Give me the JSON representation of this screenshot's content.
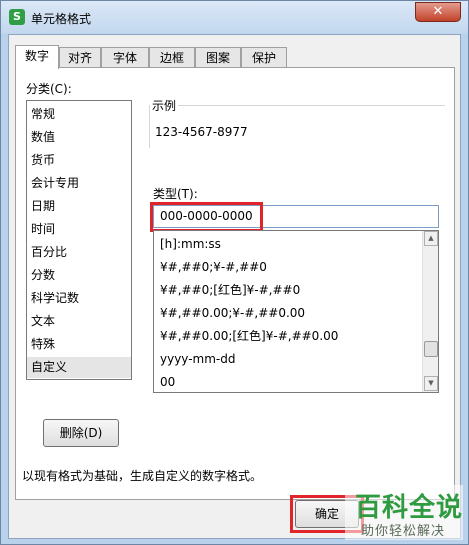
{
  "window": {
    "title": "单元格格式",
    "app_icon_glyph": "S",
    "close_glyph": "✕"
  },
  "tabs": [
    {
      "label": "数字",
      "active": true
    },
    {
      "label": "对齐",
      "active": false
    },
    {
      "label": "字体",
      "active": false
    },
    {
      "label": "边框",
      "active": false
    },
    {
      "label": "图案",
      "active": false
    },
    {
      "label": "保护",
      "active": false
    }
  ],
  "category": {
    "label": "分类(C):",
    "items": [
      "常规",
      "数值",
      "货币",
      "会计专用",
      "日期",
      "时间",
      "百分比",
      "分数",
      "科学记数",
      "文本",
      "特殊",
      "自定义"
    ],
    "selected": "自定义"
  },
  "sample": {
    "caption": "示例",
    "value": "123-4567-8977"
  },
  "type": {
    "label": "类型(T):",
    "value": "000-0000-0000",
    "formats": [
      "[h]:mm:ss",
      "¥#,##0;¥-#,##0",
      "¥#,##0;[红色]¥-#,##0",
      "¥#,##0.00;¥-#,##0.00",
      "¥#,##0.00;[红色]¥-#,##0.00",
      "yyyy-mm-dd",
      "00"
    ]
  },
  "delete_button": {
    "label": "删除(D)"
  },
  "description": "以现有格式为基础，生成自定义的数字格式。",
  "ok_button": {
    "label": "确定"
  },
  "watermark": {
    "main": "百科全说",
    "sub": "助你轻松解决"
  },
  "colors": {
    "highlight": "#e0242a",
    "watermark_green": "#2f9b40"
  }
}
